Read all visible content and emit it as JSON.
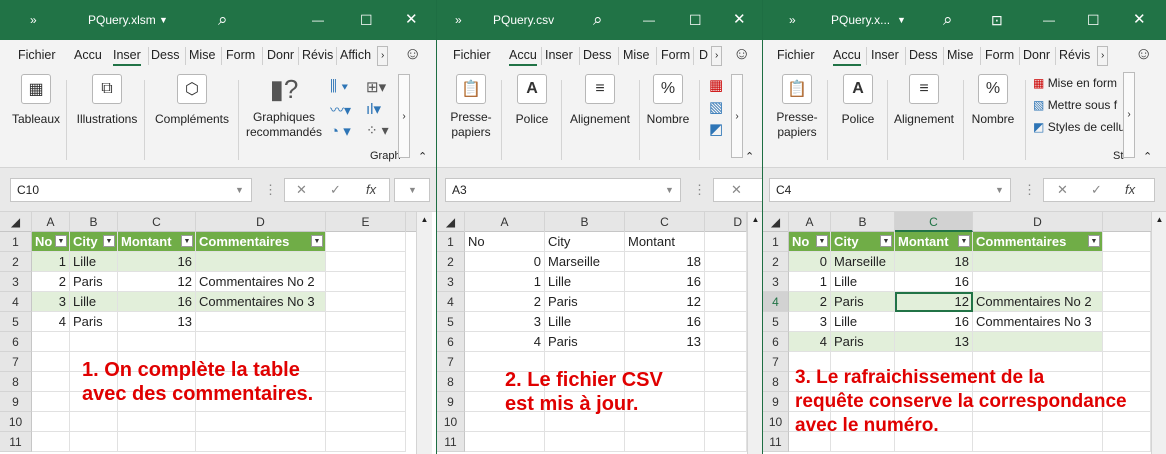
{
  "windows": [
    {
      "title": "PQuery.xlsm",
      "tabs": [
        "Fichier",
        "Accu",
        "Inser",
        "Dess",
        "Mise",
        "Form",
        "Donr",
        "Révis",
        "Affich"
      ],
      "active_tab": "Inser",
      "ribbon": {
        "groups": [
          "Tableaux",
          "Illustrations",
          "Compléments",
          "Graphiques\nrecommandés"
        ],
        "group_caption": "Graph"
      },
      "name_box": "C10",
      "columns": [
        "A",
        "B",
        "C",
        "D",
        "E"
      ],
      "rows": [
        "1",
        "2",
        "3",
        "4",
        "5",
        "6",
        "7",
        "8",
        "9",
        "10",
        "11"
      ],
      "table_headers": [
        "No",
        "City",
        "Montant",
        "Commentaires"
      ],
      "table_rows": [
        [
          "1",
          "Lille",
          "16",
          ""
        ],
        [
          "2",
          "Paris",
          "12",
          "Commentaires No 2"
        ],
        [
          "3",
          "Lille",
          "16",
          "Commentaires No 3"
        ],
        [
          "4",
          "Paris",
          "13",
          ""
        ]
      ],
      "note": [
        "1. On complète la table",
        "avec des commentaires."
      ]
    },
    {
      "title": "PQuery.csv",
      "tabs": [
        "Fichier",
        "Accu",
        "Inser",
        "Dess",
        "Mise",
        "Form",
        "D"
      ],
      "active_tab": "Accu",
      "ribbon": {
        "groups": [
          "Presse-\npapiers",
          "Police",
          "Alignement",
          "Nombre"
        ]
      },
      "name_box": "A3",
      "columns": [
        "A",
        "B",
        "C"
      ],
      "rows": [
        "1",
        "2",
        "3",
        "4",
        "5",
        "6",
        "7",
        "8",
        "9",
        "10",
        "11"
      ],
      "table_headers": [
        "No",
        "City",
        "Montant"
      ],
      "table_rows": [
        [
          "0",
          "Marseille",
          "18"
        ],
        [
          "1",
          "Lille",
          "16"
        ],
        [
          "2",
          "Paris",
          "12"
        ],
        [
          "3",
          "Lille",
          "16"
        ],
        [
          "4",
          "Paris",
          "13"
        ]
      ],
      "note": [
        "2. Le fichier CSV",
        "est mis à jour."
      ]
    },
    {
      "title": "PQuery.x...",
      "tabs": [
        "Fichier",
        "Accu",
        "Inser",
        "Dess",
        "Mise",
        "Form",
        "Donr",
        "Révis"
      ],
      "active_tab": "Accu",
      "ribbon": {
        "groups": [
          "Presse-\npapiers",
          "Police",
          "Alignement",
          "Nombre"
        ],
        "style_items": [
          "Mise en form",
          "Mettre sous f",
          "Styles de cellu"
        ],
        "group_caption": "St"
      },
      "name_box": "C4",
      "columns": [
        "A",
        "B",
        "C",
        "D"
      ],
      "rows": [
        "1",
        "2",
        "3",
        "4",
        "5",
        "6",
        "7",
        "8",
        "9",
        "10",
        "11"
      ],
      "table_headers": [
        "No",
        "City",
        "Montant",
        "Commentaires"
      ],
      "table_rows": [
        [
          "0",
          "Marseille",
          "18",
          ""
        ],
        [
          "1",
          "Lille",
          "16",
          ""
        ],
        [
          "2",
          "Paris",
          "12",
          "Commentaires No 2"
        ],
        [
          "3",
          "Lille",
          "16",
          "Commentaires No 3"
        ],
        [
          "4",
          "Paris",
          "13",
          ""
        ]
      ],
      "note": [
        "3. Le rafraichissement de la",
        "requête conserve la correspondance",
        "avec le numéro."
      ]
    }
  ],
  "icons": {
    "back": "»",
    "search": "⌕",
    "minimize": "—",
    "restore": "☐",
    "close": "✕",
    "smiley": "☺",
    "fx": "fx"
  },
  "colors": {
    "title_bar": "#217346",
    "table_header": "#70ad47",
    "band": "#e2efda",
    "note": "#e00000"
  }
}
